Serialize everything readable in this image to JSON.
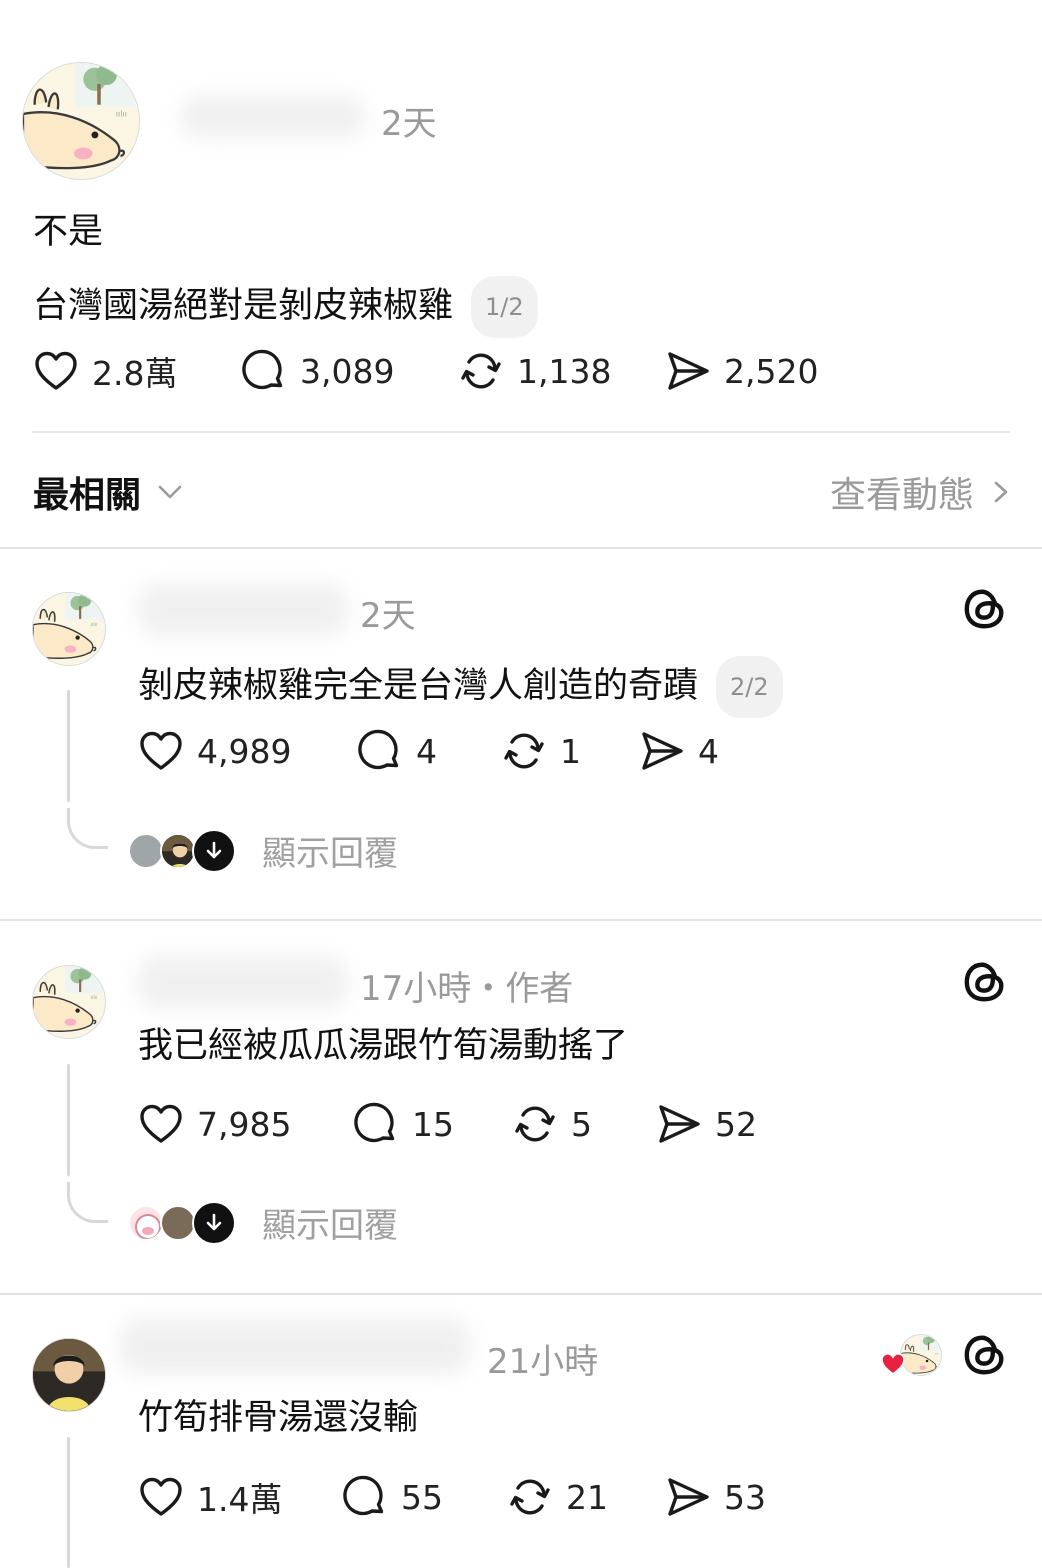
{
  "post": {
    "time": "2天",
    "lines": [
      "不是",
      "台灣國湯絕對是剝皮辣椒雞"
    ],
    "page_pill": "1/2",
    "likes": "2.8萬",
    "comments": "3,089",
    "reposts": "1,138",
    "shares": "2,520"
  },
  "sort": {
    "label": "最相關",
    "activity_label": "查看動態"
  },
  "replies": [
    {
      "time": "2天",
      "text": "剝皮辣椒雞完全是台灣人創造的奇蹟",
      "page_pill": "2/2",
      "likes": "4,989",
      "comments": "4",
      "reposts": "1",
      "shares": "4",
      "show_replies": "顯示回覆"
    },
    {
      "time": "17小時・作者",
      "text": "我已經被瓜瓜湯跟竹筍湯動搖了",
      "likes": "7,985",
      "comments": "15",
      "reposts": "5",
      "shares": "52",
      "show_replies": "顯示回覆"
    },
    {
      "time": "21小時",
      "text": "竹筍排骨湯還沒輸",
      "likes": "1.4萬",
      "comments": "55",
      "reposts": "21",
      "shares": "53"
    }
  ],
  "colors": {
    "like_red": "#e8213e",
    "divider": "#e3e3e3",
    "muted_text": "#9a9a9a"
  },
  "icons": [
    "heart-icon",
    "comment-icon",
    "repost-icon",
    "share-icon",
    "threads-logo-icon",
    "chevron-down-icon",
    "chevron-right-icon",
    "arrow-down-icon"
  ]
}
